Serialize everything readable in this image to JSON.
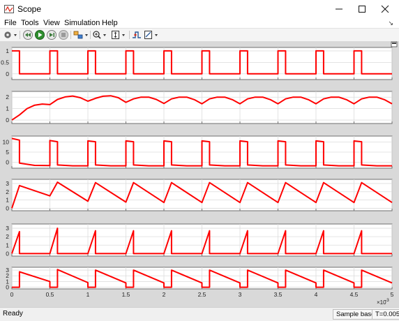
{
  "window": {
    "title": "Scope",
    "controls": [
      "minimize-icon",
      "maximize-icon",
      "close-icon"
    ]
  },
  "menu": {
    "items": [
      "File",
      "Tools",
      "View",
      "Simulation",
      "Help"
    ]
  },
  "toolbar": {
    "icons": [
      "gear-icon",
      "rewind-icon",
      "run-icon",
      "step-forward-icon",
      "stop-icon",
      "highlight-icon",
      "zoom-icon",
      "fit-icon",
      "triggers-icon",
      "cursor-measure-icon"
    ]
  },
  "colors": {
    "signal": "#ff0000",
    "plot_background": "#ffffff",
    "frame": "#d9d9d9"
  },
  "status": {
    "left": "Ready",
    "mode": "Sample based",
    "time": "T=0.005"
  },
  "chart_data": {
    "type": "line",
    "time_label": "×10",
    "time_exponent": "-3",
    "xlim": [
      0,
      5
    ],
    "x_ticks": [
      "0",
      "0.5",
      "1",
      "1.5",
      "2",
      "2.5",
      "3",
      "3.5",
      "4",
      "4.5",
      "5"
    ],
    "grid": true,
    "period": 0.5,
    "axes": [
      {
        "ylim": [
          -0.25,
          1.15
        ],
        "yticks": [
          "0",
          "0.5",
          "1"
        ],
        "x": [
          0,
          0.0001,
          0.1,
          0.1001,
          0.5,
          0.5001,
          0.6,
          0.6001,
          1.0,
          1.0001,
          1.1,
          1.1001,
          1.5,
          1.5001,
          1.6,
          1.6001,
          2.0,
          2.0001,
          2.1,
          2.1001,
          2.5,
          2.5001,
          2.6,
          2.6001,
          3.0,
          3.0001,
          3.1,
          3.1001,
          3.5,
          3.5001,
          3.6,
          3.6001,
          4.0,
          4.0001,
          4.1,
          4.1001,
          4.5,
          4.5001,
          4.6,
          4.6001,
          5.0
        ],
        "y": [
          1,
          1,
          1,
          0,
          0,
          1,
          1,
          0,
          0,
          1,
          1,
          0,
          0,
          1,
          1,
          0,
          0,
          1,
          1,
          0,
          0,
          1,
          1,
          0,
          0,
          1,
          1,
          0,
          0,
          1,
          1,
          0,
          0,
          1,
          1,
          0,
          0,
          1,
          1,
          0,
          0
        ]
      },
      {
        "ylim": [
          -0.3,
          2.5
        ],
        "yticks": [
          "0",
          "1",
          "2"
        ],
        "x": [
          0,
          0.1,
          0.2,
          0.3,
          0.4,
          0.5,
          0.6,
          0.7,
          0.8,
          0.9,
          1.0,
          1.1,
          1.2,
          1.3,
          1.4,
          1.5,
          1.6,
          1.7,
          1.8,
          1.9,
          2.0,
          2.1,
          2.2,
          2.3,
          2.4,
          2.5,
          2.6,
          2.7,
          2.8,
          2.9,
          3.0,
          3.1,
          3.2,
          3.3,
          3.4,
          3.5,
          3.6,
          3.7,
          3.8,
          3.9,
          4.0,
          4.1,
          4.2,
          4.3,
          4.4,
          4.5,
          4.6,
          4.7,
          4.8,
          4.9,
          5.0
        ],
        "y": [
          0,
          0.45,
          1.0,
          1.3,
          1.4,
          1.35,
          1.8,
          2.02,
          2.1,
          1.95,
          1.65,
          1.9,
          2.08,
          2.12,
          1.95,
          1.55,
          1.85,
          2.0,
          2.0,
          1.8,
          1.45,
          1.85,
          2.0,
          2.0,
          1.78,
          1.42,
          1.85,
          2.0,
          2.0,
          1.78,
          1.42,
          1.85,
          2.0,
          2.0,
          1.78,
          1.42,
          1.85,
          2.0,
          2.0,
          1.78,
          1.42,
          1.85,
          2.0,
          2.0,
          1.78,
          1.42,
          1.85,
          2.0,
          2.0,
          1.78,
          1.42
        ]
      },
      {
        "ylim": [
          -3,
          13
        ],
        "yticks": [
          "0",
          "5",
          "10"
        ],
        "x": [
          0,
          0.0001,
          0.1,
          0.1001,
          0.3,
          0.5,
          0.5001,
          0.6,
          0.6001,
          0.8,
          1.0,
          1.0001,
          1.1,
          1.1001,
          1.3,
          1.5,
          1.5001,
          1.6,
          1.6001,
          1.8,
          2.0,
          2.0001,
          2.1,
          2.1001,
          2.3,
          2.5,
          2.5001,
          2.6,
          2.6001,
          2.8,
          3.0,
          3.0001,
          3.1,
          3.1001,
          3.3,
          3.5,
          3.5001,
          3.6,
          3.6001,
          3.8,
          4.0,
          4.0001,
          4.1,
          4.1001,
          4.3,
          4.5,
          4.5001,
          4.6,
          4.6001,
          4.8,
          5.0
        ],
        "y": [
          11.8,
          11.8,
          11.0,
          -0.5,
          -1.6,
          -1.7,
          10.8,
          10.2,
          -1.4,
          -1.8,
          -1.8,
          10.6,
          10.2,
          -1.4,
          -1.8,
          -1.8,
          10.6,
          10.2,
          -1.4,
          -1.8,
          -1.8,
          10.6,
          10.2,
          -1.4,
          -1.8,
          -1.8,
          10.6,
          10.2,
          -1.4,
          -1.8,
          -1.8,
          10.6,
          10.2,
          -1.4,
          -1.8,
          -1.8,
          10.6,
          10.2,
          -1.4,
          -1.8,
          -1.8,
          10.6,
          10.2,
          -1.4,
          -1.8,
          -1.8,
          10.6,
          10.2,
          -1.4,
          -1.8,
          -1.8
        ]
      },
      {
        "ylim": [
          -0.3,
          3.5
        ],
        "yticks": [
          "0",
          "1",
          "2",
          "3"
        ],
        "x": [
          0,
          0.1,
          0.5,
          0.6,
          1.0,
          1.1,
          1.5,
          1.6,
          2.0,
          2.1,
          2.5,
          2.6,
          3.0,
          3.1,
          3.5,
          3.6,
          4.0,
          4.1,
          4.5,
          4.6,
          5.0
        ],
        "y": [
          0,
          2.75,
          1.5,
          3.15,
          0.85,
          3.1,
          0.75,
          3.1,
          0.7,
          3.1,
          0.7,
          3.1,
          0.7,
          3.1,
          0.7,
          3.1,
          0.7,
          3.1,
          0.7,
          3.1,
          0.7
        ]
      },
      {
        "ylim": [
          -0.3,
          3.5
        ],
        "yticks": [
          "0",
          "1",
          "2",
          "3"
        ],
        "x": [
          0,
          0.1,
          0.1001,
          0.5,
          0.6,
          0.6001,
          1.0,
          1.1,
          1.1001,
          1.5,
          1.6,
          1.6001,
          2.0,
          2.1,
          2.1001,
          2.5,
          2.6,
          2.6001,
          3.0,
          3.1,
          3.1001,
          3.5,
          3.6,
          3.6001,
          4.0,
          4.1,
          4.1001,
          4.5,
          4.6,
          4.6001,
          5.0
        ],
        "y": [
          0,
          2.6,
          0,
          0,
          3.0,
          0,
          0,
          2.7,
          0,
          0,
          2.7,
          0,
          0,
          2.7,
          0,
          0,
          2.7,
          0,
          0,
          2.7,
          0,
          0,
          2.7,
          0,
          0,
          2.7,
          0,
          0,
          2.7,
          0,
          0
        ]
      },
      {
        "ylim": [
          -0.3,
          3.5
        ],
        "yticks": [
          "0",
          "1",
          "2",
          "3"
        ],
        "x": [
          0,
          0.0001,
          0.1,
          0.1001,
          0.5,
          0.5001,
          0.6,
          0.6001,
          1.0,
          1.0001,
          1.1,
          1.1001,
          1.5,
          1.5001,
          1.6,
          1.6001,
          2.0,
          2.0001,
          2.1,
          2.1001,
          2.5,
          2.5001,
          2.6,
          2.6001,
          3.0,
          3.0001,
          3.1,
          3.1001,
          3.5,
          3.5001,
          3.6,
          3.6001,
          4.0,
          4.0001,
          4.1,
          4.1001,
          4.5,
          4.5001,
          4.6,
          4.6001,
          5.0
        ],
        "y": [
          0,
          0,
          0,
          2.7,
          1.0,
          0,
          0,
          3.1,
          0.8,
          0,
          0,
          3.0,
          0.75,
          0,
          0,
          3.0,
          0.75,
          0,
          0,
          3.0,
          0.75,
          0,
          0,
          3.0,
          0.75,
          0,
          0,
          3.0,
          0.75,
          0,
          0,
          3.0,
          0.75,
          0,
          0,
          3.0,
          0.75,
          0,
          0,
          3.0,
          0.75
        ]
      }
    ]
  }
}
